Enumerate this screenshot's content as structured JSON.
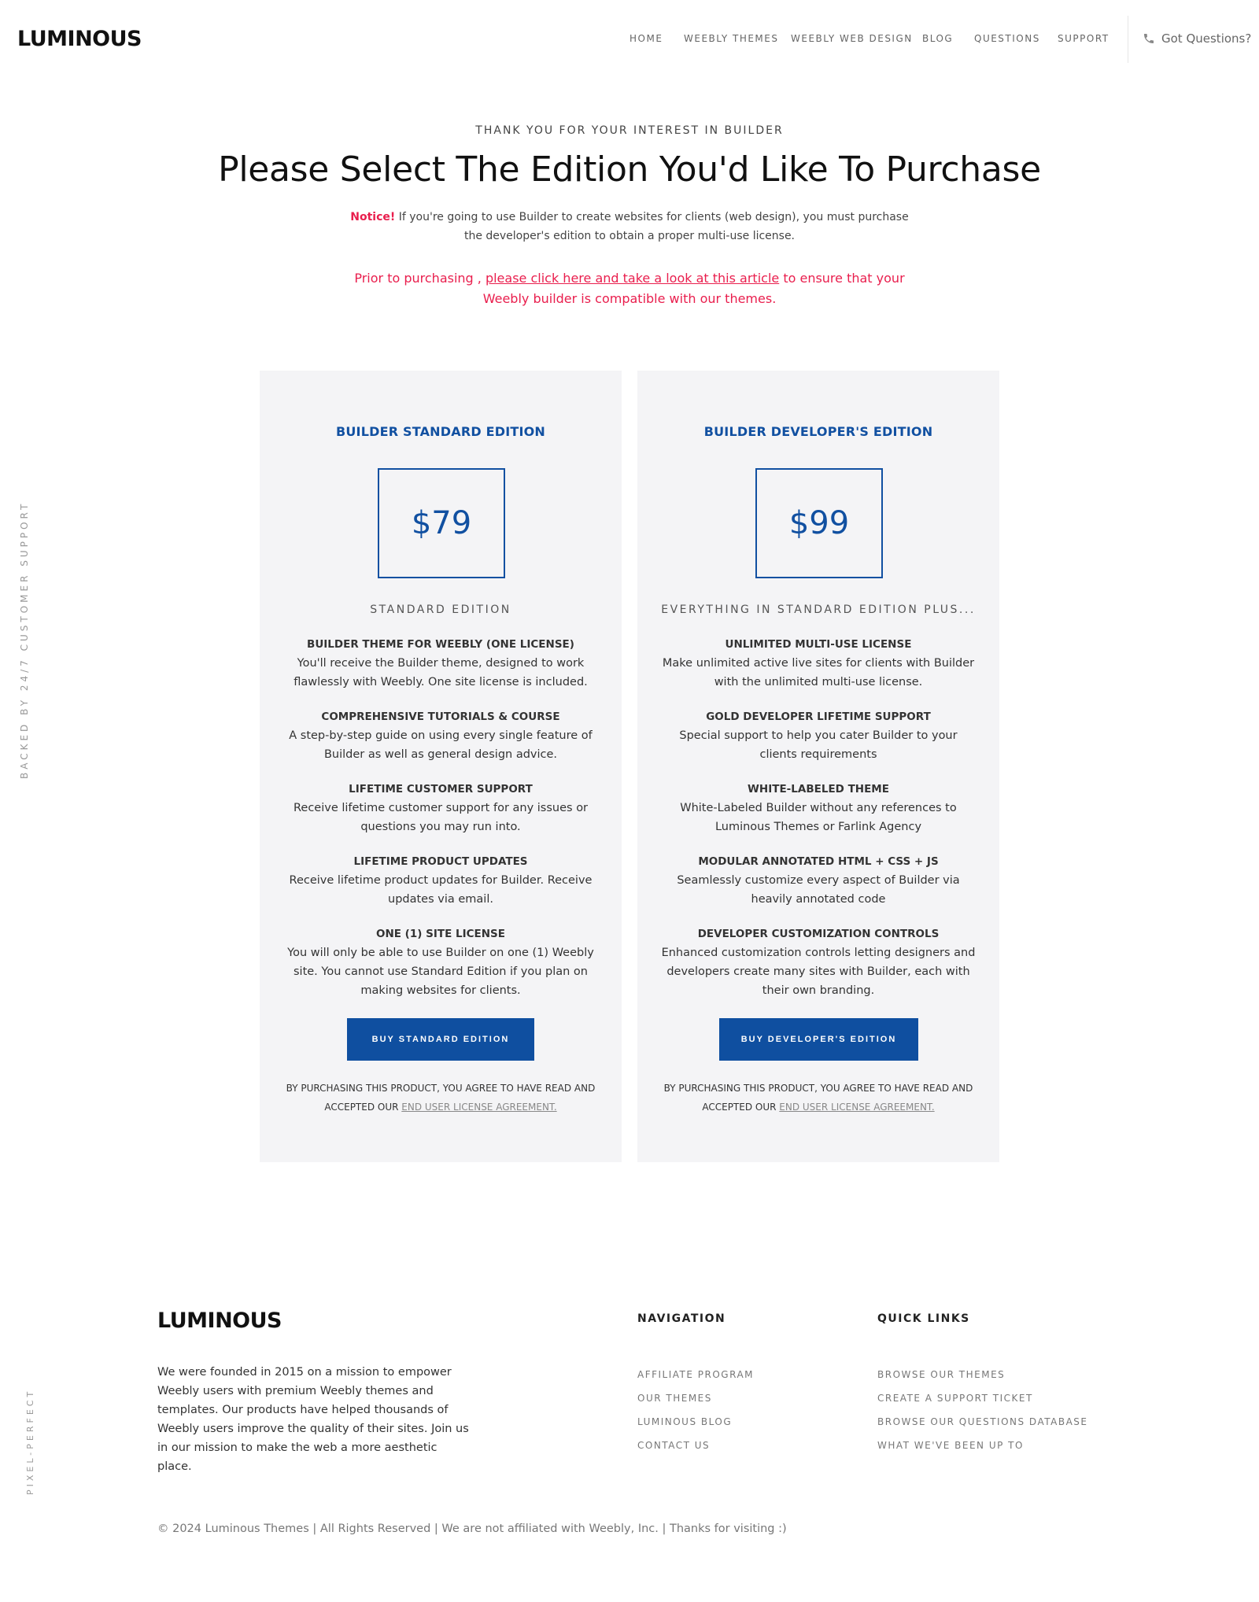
{
  "brand": {
    "logo_text": "LUMINOUS"
  },
  "nav": {
    "items": [
      {
        "label": "HOME"
      },
      {
        "label": "WEEBLY THEMES"
      },
      {
        "label": "WEEBLY WEB DESIGN"
      },
      {
        "label": "BLOG"
      },
      {
        "label": "QUESTIONS"
      },
      {
        "label": "SUPPORT"
      }
    ],
    "contact_label": "Got Questions?"
  },
  "side": {
    "support_text": "BACKED BY 24/7 CUSTOMER SUPPORT",
    "pixel_text": "PIXEL-PERFECT"
  },
  "hero": {
    "eyebrow": "THANK YOU FOR YOUR INTEREST IN BUILDER",
    "title": "Please Select The Edition You'd Like To Purchase",
    "notice_label": "Notice!",
    "notice_text": " If you're going to use Builder to create websites for clients (web design), you must purchase the developer's edition to obtain a proper multi-use license.",
    "prior_prefix": "Prior to purchasing , ",
    "prior_link": "please click here and take a look at this article",
    "prior_suffix": " to ensure that your Weebly builder is compatible with our themes."
  },
  "editions": [
    {
      "title": "BUILDER STANDARD EDITION",
      "price": "$79",
      "subhead": "STANDARD EDITION",
      "features": [
        {
          "title": "BUILDER THEME FOR WEEBLY (ONE LICENSE)",
          "desc": "You'll receive the Builder theme, designed to work flawlessly with Weebly. One site license is included."
        },
        {
          "title": "COMPREHENSIVE TUTORIALS & COURSE",
          "desc": "A step-by-step guide on using every single feature of Builder as well as general design advice."
        },
        {
          "title": "LIFETIME CUSTOMER SUPPORT",
          "desc": "Receive lifetime customer support for any issues or questions you may run into."
        },
        {
          "title": "LIFETIME PRODUCT UPDATES",
          "desc": "Receive lifetime product updates for Builder. Receive updates via email."
        },
        {
          "title": "ONE (1) SITE LICENSE",
          "desc": "You will only be able to use Builder on one (1) Weebly site. You cannot use Standard Edition if you plan on making websites for clients."
        }
      ],
      "button": "BUY STANDARD EDITION",
      "terms_text": "BY PURCHASING THIS PRODUCT, YOU AGREE TO HAVE READ AND ACCEPTED OUR ",
      "terms_link": "END USER LICENSE AGREEMENT."
    },
    {
      "title": "BUILDER DEVELOPER'S EDITION",
      "price": "$99",
      "subhead": "EVERYTHING IN STANDARD EDITION PLUS...",
      "features": [
        {
          "title": "UNLIMITED MULTI-USE LICENSE",
          "desc": "Make unlimited active live sites for clients with Builder with the unlimited multi-use license."
        },
        {
          "title": "GOLD DEVELOPER LIFETIME SUPPORT",
          "desc": "Special support to help you cater Builder to your clients requirements"
        },
        {
          "title": "WHITE-LABELED THEME",
          "desc": "White-Labeled Builder without any references to Luminous Themes or Farlink Agency"
        },
        {
          "title": "MODULAR ANNOTATED HTML + CSS + JS",
          "desc": "Seamlessly customize every aspect of Builder via heavily annotated code"
        },
        {
          "title": "DEVELOPER CUSTOMIZATION CONTROLS",
          "desc": "Enhanced customization controls letting designers and developers create many sites with Builder, each with their own branding."
        }
      ],
      "button": "BUY DEVELOPER'S EDITION",
      "terms_text": "BY PURCHASING THIS PRODUCT, YOU AGREE TO HAVE READ AND ACCEPTED OUR ",
      "terms_link": "END USER LICENSE AGREEMENT."
    }
  ],
  "footer": {
    "about": "We were founded in 2015 on a mission to empower Weebly users with premium Weebly themes and templates. Our products have helped thousands of Weebly users improve the quality of their sites. Join us in our mission to make the web a more aesthetic place.",
    "navigation_title": "NAVIGATION",
    "navigation_links": [
      "AFFILIATE PROGRAM",
      "OUR THEMES",
      "LUMINOUS BLOG",
      "CONTACT US"
    ],
    "quick_title": "QUICK LINKS",
    "quick_links": [
      "BROWSE OUR THEMES",
      "CREATE A SUPPORT TICKET",
      "BROWSE OUR QUESTIONS DATABASE",
      "WHAT WE'VE BEEN UP TO"
    ],
    "copyright": "© 2024 Luminous Themes | All Rights Reserved | We are not affiliated with Weebly, Inc. | Thanks for visiting :)"
  },
  "colors": {
    "accent": "#1150a1",
    "notice": "#e91e4d",
    "card_bg": "#f4f4f6"
  },
  "icons": {
    "contact": "phone-icon"
  }
}
